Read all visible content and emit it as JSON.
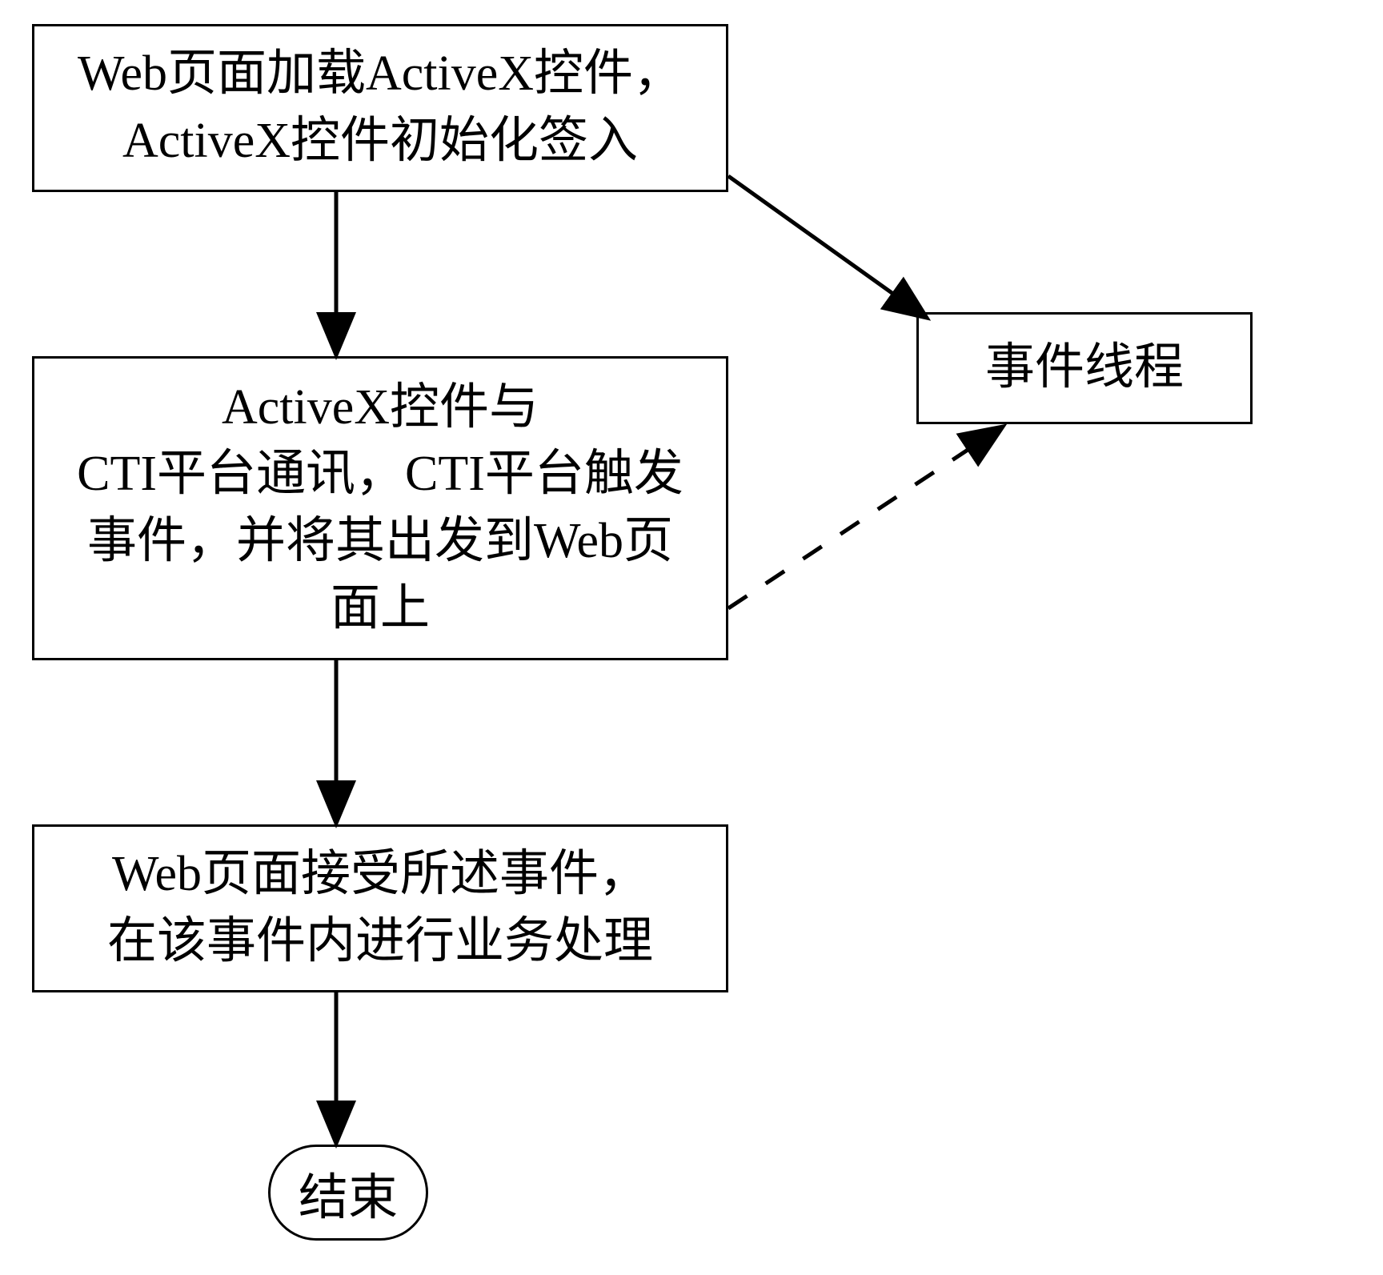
{
  "flowchart": {
    "box1": {
      "line1": "Web页面加载ActiveX控件，",
      "line2": "ActiveX控件初始化签入"
    },
    "box2": {
      "line1": "ActiveX控件与",
      "line2": "CTI平台通讯，CTI平台触发",
      "line3": "事件，并将其出发到Web页",
      "line4": "面上"
    },
    "box3": {
      "line1": "Web页面接受所述事件，",
      "line2": "在该事件内进行业务处理"
    },
    "side_box": "事件线程",
    "end": "结束"
  }
}
